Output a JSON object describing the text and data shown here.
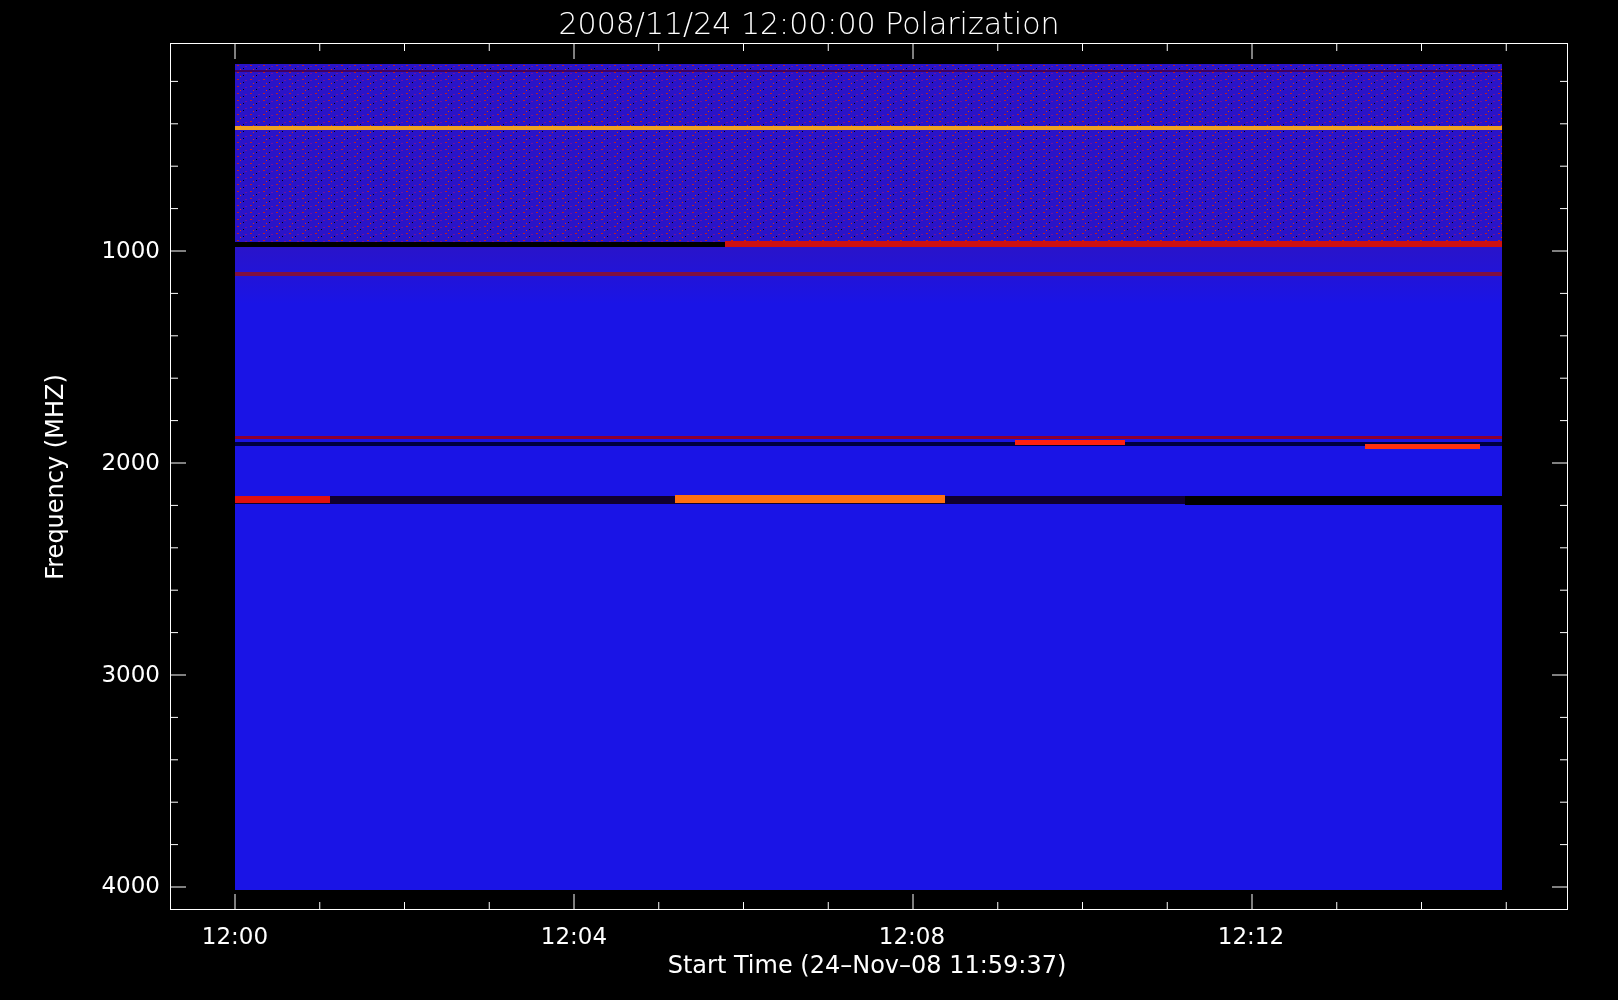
{
  "title": "2008/11/24 12:00:00 Polarization",
  "y_axis": {
    "label": "Frequency (MHZ)",
    "ticks": [
      "1000",
      "2000",
      "3000",
      "4000"
    ]
  },
  "x_axis": {
    "label": "Start Time (24–Nov–08 11:59:37)",
    "ticks": [
      "12:00",
      "12:04",
      "12:08",
      "12:12"
    ]
  }
}
